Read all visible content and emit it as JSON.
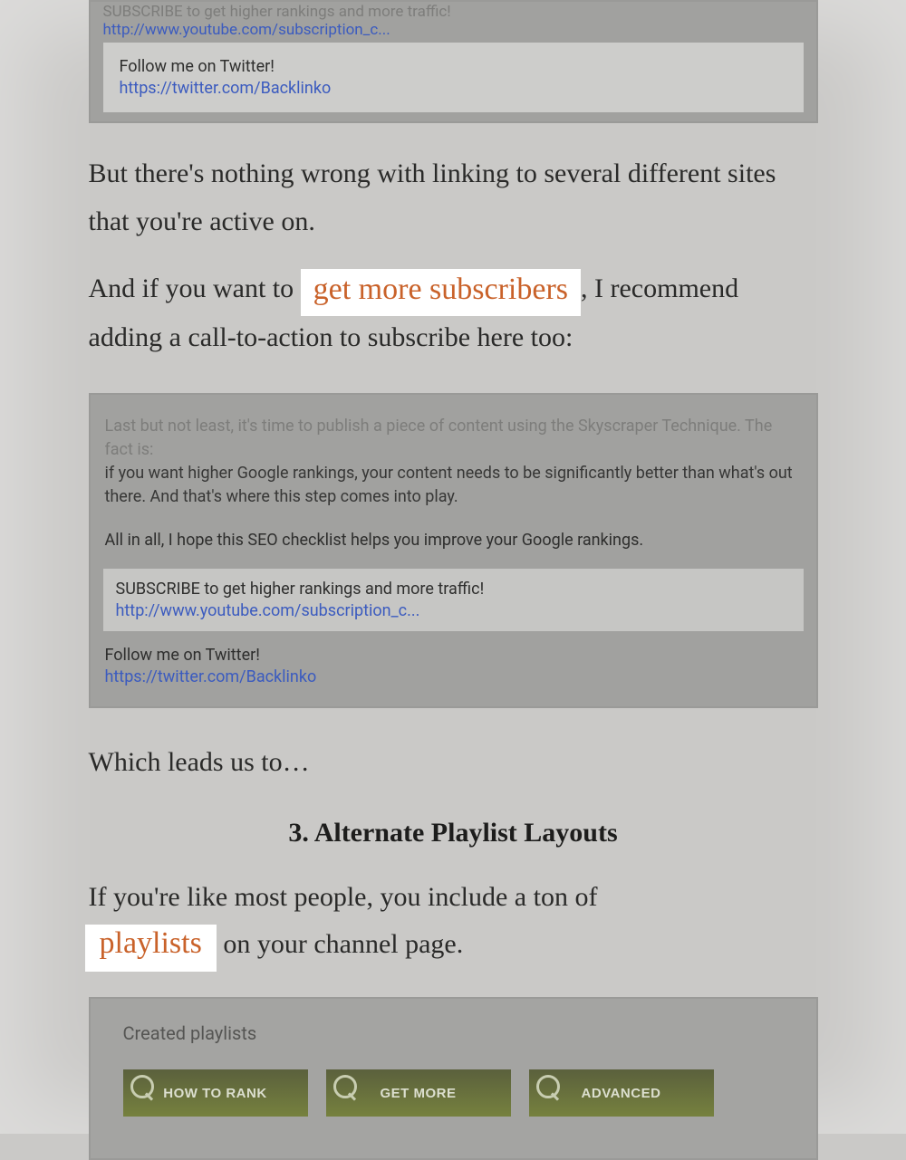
{
  "panelTop": {
    "subscribeTrail": "SUBSCRIBE to get higher rankings and more traffic!",
    "subscribeUrl": "http://www.youtube.com/subscription_c...",
    "twitterLabel": "Follow me on Twitter!",
    "twitterUrl": "https://twitter.com/Backlinko"
  },
  "para1": "But there's nothing wrong with linking to several different sites that you're active on.",
  "para2a": "And if you want to ",
  "para2Link": "get more subscribers",
  "para2b": ", I recommend adding a call-to-action to subscribe here too:",
  "panelMid": {
    "fadeLine": "Last but not least, it's time to publish a piece of content using the Skyscraper Technique. The fact is:",
    "line2": "if you want higher Google rankings, your content needs to be significantly better than what's out there. And that's where this step comes into play.",
    "line3": "All in all, I hope this SEO checklist helps you improve your Google rankings.",
    "subscribeLabel": "SUBSCRIBE to get higher rankings and more traffic!",
    "subscribeUrl": "http://www.youtube.com/subscription_c...",
    "twitterLabel": "Follow me on Twitter!",
    "twitterUrl": "https://twitter.com/Backlinko"
  },
  "para3": "Which leads us to…",
  "heading": "3. Alternate Playlist Layouts",
  "para4a": "If you're like most people, you include a ton of ",
  "para4Link": "playlists",
  "para4b": " on your channel page.",
  "playlists": {
    "title": "Created playlists",
    "cards": [
      "HOW TO RANK",
      "GET MORE",
      "ADVANCED"
    ]
  }
}
